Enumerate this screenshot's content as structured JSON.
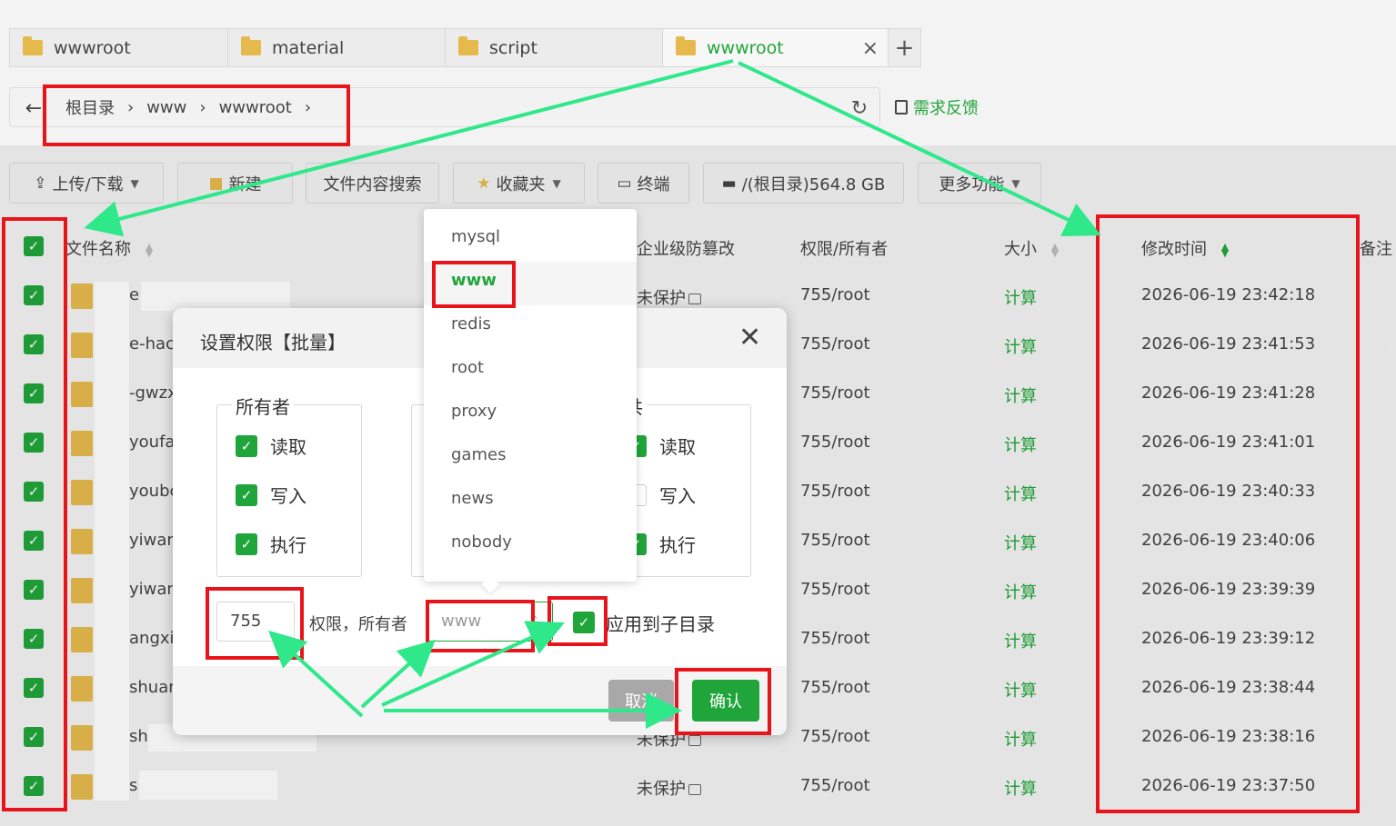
{
  "tabs": [
    {
      "label": "wwwroot",
      "active": false
    },
    {
      "label": "material",
      "active": false
    },
    {
      "label": "script",
      "active": false
    },
    {
      "label": "wwwroot",
      "active": true
    }
  ],
  "tab_add": "+",
  "tab_close": "×",
  "path": {
    "crumbs": [
      "根目录",
      "www",
      "wwwroot"
    ],
    "feedback": "需求反馈"
  },
  "toolbar": {
    "upload": "上传/下载",
    "new": "新建",
    "search": "文件内容搜索",
    "favorites": "收藏夹",
    "terminal": "终端",
    "disk": "/(根目录)564.8 GB",
    "more": "更多功能"
  },
  "table": {
    "headers": {
      "name": "文件名称",
      "protect": "企业级防篡改",
      "perm": "权限/所有者",
      "size": "大小",
      "mtime": "修改时间",
      "remark": "备注"
    },
    "rows": [
      {
        "name": "e",
        "protect": "未保护",
        "perm": "755/root",
        "size": "计算",
        "mtime": "2026-06-19 23:42:18"
      },
      {
        "name": "e-hac",
        "protect": "",
        "perm": "755/root",
        "size": "计算",
        "mtime": "2026-06-19 23:41:53"
      },
      {
        "name": "-gwzx",
        "protect": "",
        "perm": "755/root",
        "size": "计算",
        "mtime": "2026-06-19 23:41:28"
      },
      {
        "name": "youfa",
        "protect": "",
        "perm": "755/root",
        "size": "计算",
        "mtime": "2026-06-19 23:41:01"
      },
      {
        "name": "youbc",
        "protect": "",
        "perm": "755/root",
        "size": "计算",
        "mtime": "2026-06-19 23:40:33"
      },
      {
        "name": "yiwan",
        "protect": "",
        "perm": "755/root",
        "size": "计算",
        "mtime": "2026-06-19 23:40:06"
      },
      {
        "name": "yiwan",
        "protect": "",
        "perm": "755/root",
        "size": "计算",
        "mtime": "2026-06-19 23:39:39"
      },
      {
        "name": "angxi",
        "protect": "",
        "perm": "755/root",
        "size": "计算",
        "mtime": "2026-06-19 23:39:12"
      },
      {
        "name": "shuan",
        "protect": "",
        "perm": "755/root",
        "size": "计算",
        "mtime": "2026-06-19 23:38:44"
      },
      {
        "name": "sh",
        "protect": "未保护",
        "perm": "755/root",
        "size": "计算",
        "mtime": "2026-06-19 23:38:16"
      },
      {
        "name": "s",
        "protect": "未保护",
        "perm": "755/root",
        "size": "计算",
        "mtime": "2026-06-19 23:37:50"
      }
    ]
  },
  "modal": {
    "title": "设置权限【批量】",
    "groups": [
      {
        "legend": "所有者",
        "options": [
          {
            "label": "读取",
            "checked": true
          },
          {
            "label": "写入",
            "checked": true
          },
          {
            "label": "执行",
            "checked": true
          }
        ]
      },
      {
        "legend": "",
        "options": []
      },
      {
        "legend": "共",
        "options": [
          {
            "label": "读取",
            "checked": true
          },
          {
            "label": "写入",
            "checked": false
          },
          {
            "label": "执行",
            "checked": true
          }
        ]
      }
    ],
    "perm_value": "755",
    "perm_label": "权限，所有者",
    "owner_value": "www",
    "apply_label": "应用到子目录",
    "cancel": "取消",
    "confirm": "确认"
  },
  "dropdown": {
    "options": [
      "mysql",
      "www",
      "redis",
      "root",
      "proxy",
      "games",
      "news",
      "nobody"
    ],
    "selected": "www"
  },
  "colors": {
    "accent": "#20a53a",
    "annotation_red": "#e8141b",
    "annotation_arrow": "#2ee88a"
  }
}
